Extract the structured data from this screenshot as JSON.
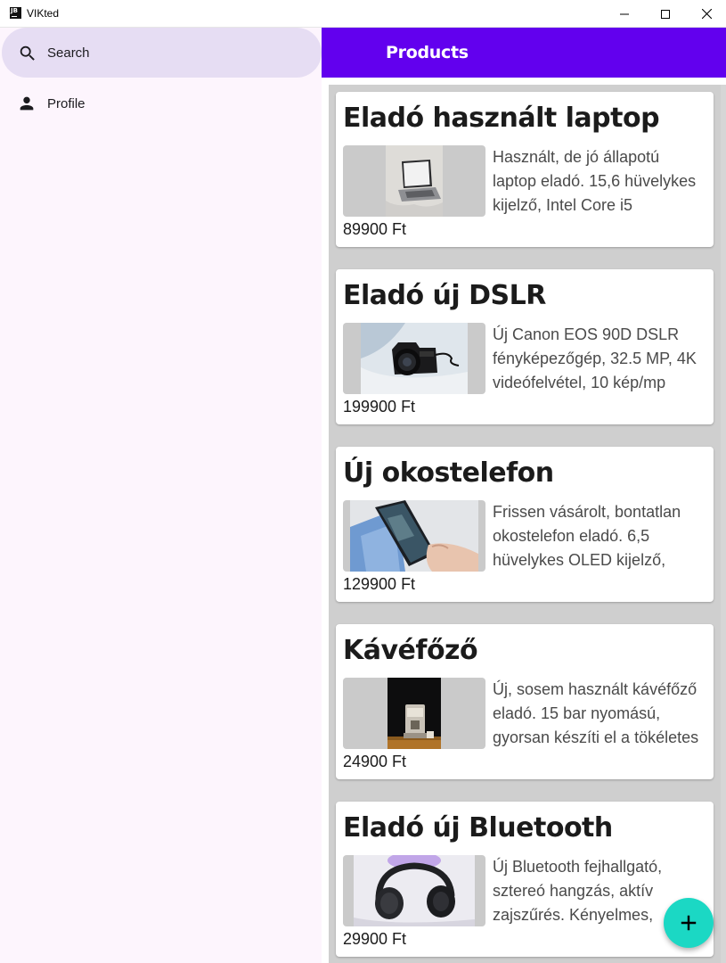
{
  "window": {
    "title": "VIKted",
    "icon_label": "JB",
    "controls": [
      "minimize-icon",
      "maximize-icon",
      "close-icon"
    ]
  },
  "sidebar": {
    "items": [
      {
        "label": "Search",
        "icon": "search-icon",
        "selected": true
      },
      {
        "label": "Profile",
        "icon": "person-icon",
        "selected": false
      }
    ]
  },
  "appbar": {
    "title": "Products"
  },
  "products": [
    {
      "title": "Eladó használt laptop",
      "description": "Használt, de jó állapotú laptop eladó. 15,6 hüvelykes kijelző, Intel Core i5",
      "price": "89900 Ft",
      "image": "laptop-image"
    },
    {
      "title": "Eladó új DSLR",
      "description": "Új Canon EOS 90D DSLR fényképezőgép, 32.5 MP, 4K videófelvétel, 10 kép/mp",
      "price": "199900 Ft",
      "image": "camera-image"
    },
    {
      "title": "Új okostelefon",
      "description": "Frissen vásárolt, bontatlan okostelefon eladó. 6,5 hüvelykes OLED kijelző,",
      "price": "129900 Ft",
      "image": "smartphone-image"
    },
    {
      "title": "Kávéfőző",
      "description": "Új, sosem használt kávéfőző eladó. 15 bar nyomású, gyorsan készíti el a tökéletes",
      "price": "24900 Ft",
      "image": "coffee-maker-image"
    },
    {
      "title": "Eladó új Bluetooth",
      "description": "Új Bluetooth fejhallgató, sztereó hangzás, aktív zajszűrés. Kényelmes,",
      "price": "29900 Ft",
      "image": "headphones-image"
    }
  ],
  "fab": {
    "icon": "add-icon"
  },
  "colors": {
    "appbar": "#6200ee",
    "fab": "#1bd8c4",
    "sidebar_bg": "#fdf5fd",
    "selected_nav": "#e6ddf3"
  }
}
